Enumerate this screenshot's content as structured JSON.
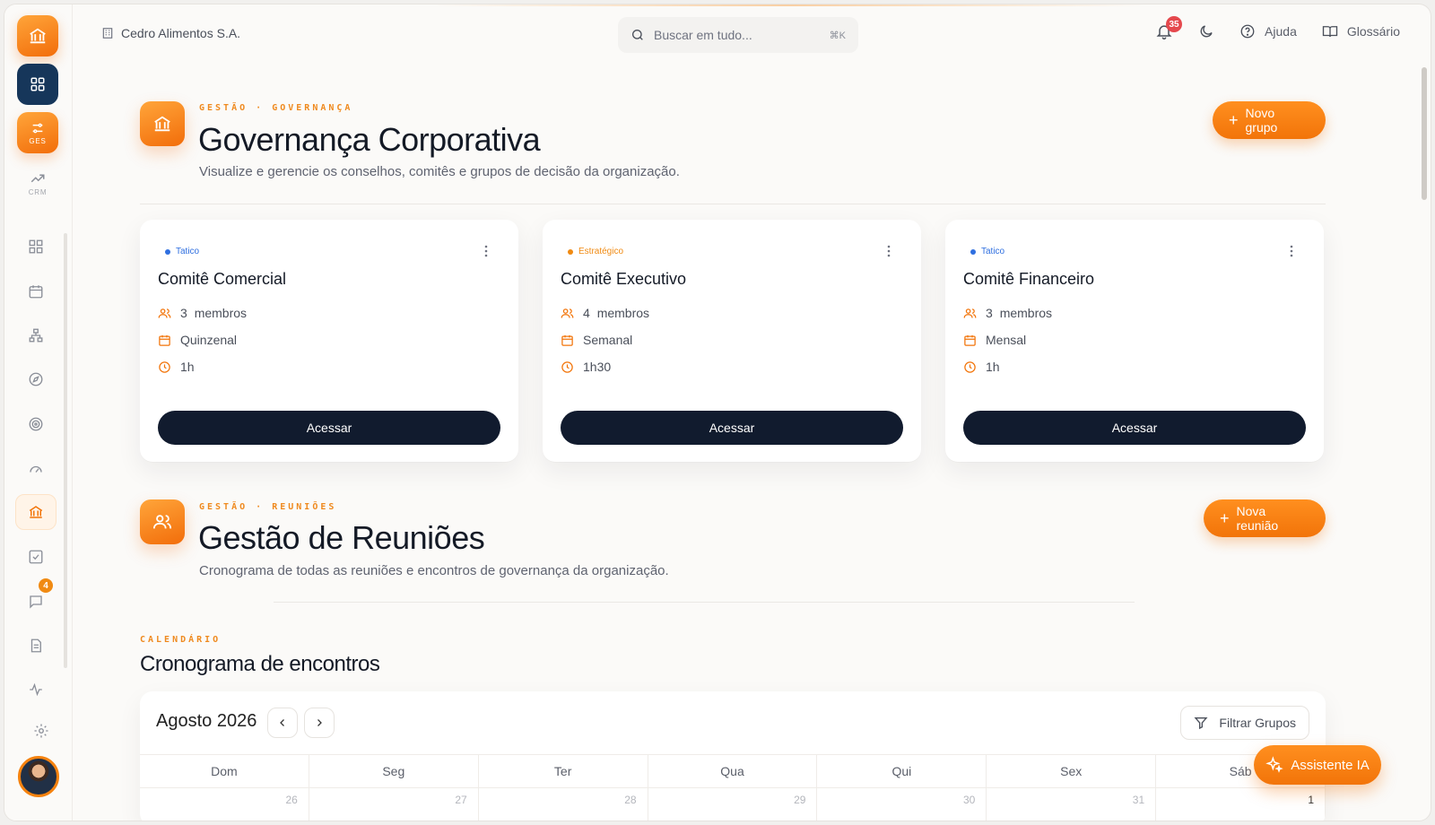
{
  "topbar": {
    "company": "Cedro Alimentos S.A.",
    "search_placeholder": "Buscar em tudo...",
    "search_shortcut": "⌘K",
    "notifications_count": "35",
    "help_label": "Ajuda",
    "glossary_label": "Glossário"
  },
  "rail": {
    "ges_tag": "GES",
    "crm_tag": "CRM",
    "messages_badge": "4"
  },
  "governance": {
    "eyebrow_1": "GESTÃO",
    "eyebrow_sep": "·",
    "eyebrow_2": "GOVERNANÇA",
    "title": "Governança Corporativa",
    "subtitle": "Visualize e gerencie os conselhos, comitês e grupos de decisão da organização.",
    "new_button": "Novo grupo",
    "cards": [
      {
        "tag": "Tatico",
        "tag_color": "#2f6fe0",
        "name": "Comitê Comercial",
        "members_count": "3",
        "members_label": "membros",
        "frequency": "Quinzenal",
        "duration": "1h",
        "cta": "Acessar"
      },
      {
        "tag": "Estratégico",
        "tag_color": "#f08a12",
        "name": "Comitê Executivo",
        "members_count": "4",
        "members_label": "membros",
        "frequency": "Semanal",
        "duration": "1h30",
        "cta": "Acessar"
      },
      {
        "tag": "Tatico",
        "tag_color": "#2f6fe0",
        "name": "Comitê Financeiro",
        "members_count": "3",
        "members_label": "membros",
        "frequency": "Mensal",
        "duration": "1h",
        "cta": "Acessar"
      }
    ]
  },
  "meetings": {
    "eyebrow_1": "GESTÃO",
    "eyebrow_sep": "·",
    "eyebrow_2": "REUNIÕES",
    "title": "Gestão de Reuniões",
    "subtitle": "Cronograma de todas as reuniões e encontros de governança da organização.",
    "new_button": "Nova reunião"
  },
  "calendar": {
    "eyebrow": "CALENDÁRIO",
    "title": "Cronograma de encontros",
    "month": "Agosto 2026",
    "filter_label": "Filtrar Grupos",
    "weekdays": [
      "Dom",
      "Seg",
      "Ter",
      "Qua",
      "Qui",
      "Sex",
      "Sáb"
    ],
    "first_week": [
      "26",
      "27",
      "28",
      "29",
      "30",
      "31",
      "1"
    ]
  },
  "assistant_label": "Assistente IA",
  "colors": {
    "accent": "#f27409",
    "navy": "#111b2e",
    "apps_tile": "#16365a",
    "danger": "#e5484d"
  }
}
